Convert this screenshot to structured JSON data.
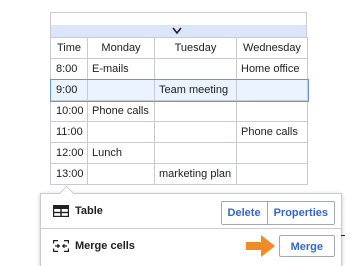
{
  "table": {
    "headers": [
      "Time",
      "Monday",
      "Tuesday",
      "Wednesday"
    ],
    "rows": [
      [
        "8:00",
        "E-mails",
        "",
        "Home office"
      ],
      [
        "9:00",
        "",
        "Team meeting",
        ""
      ],
      [
        "10:00",
        "Phone calls",
        "",
        ""
      ],
      [
        "11:00",
        "",
        "",
        "Phone calls"
      ],
      [
        "12:00",
        "Lunch",
        "",
        ""
      ],
      [
        "13:00",
        "",
        "marketing plan",
        ""
      ]
    ],
    "selected_row_index": 1
  },
  "panel": {
    "table_section": {
      "label": "Table",
      "icon": "table-icon",
      "delete_label": "Delete",
      "properties_label": "Properties"
    },
    "merge_section": {
      "label": "Merge cells",
      "icon": "merge-cells-icon",
      "merge_label": "Merge"
    }
  },
  "colors": {
    "accent_link": "#3366cc",
    "selection_fill": "#eaf3ff",
    "insert_bar": "#dbe6fb",
    "pointer_arrow": "#f08c24",
    "border": "#c8ccd1"
  }
}
